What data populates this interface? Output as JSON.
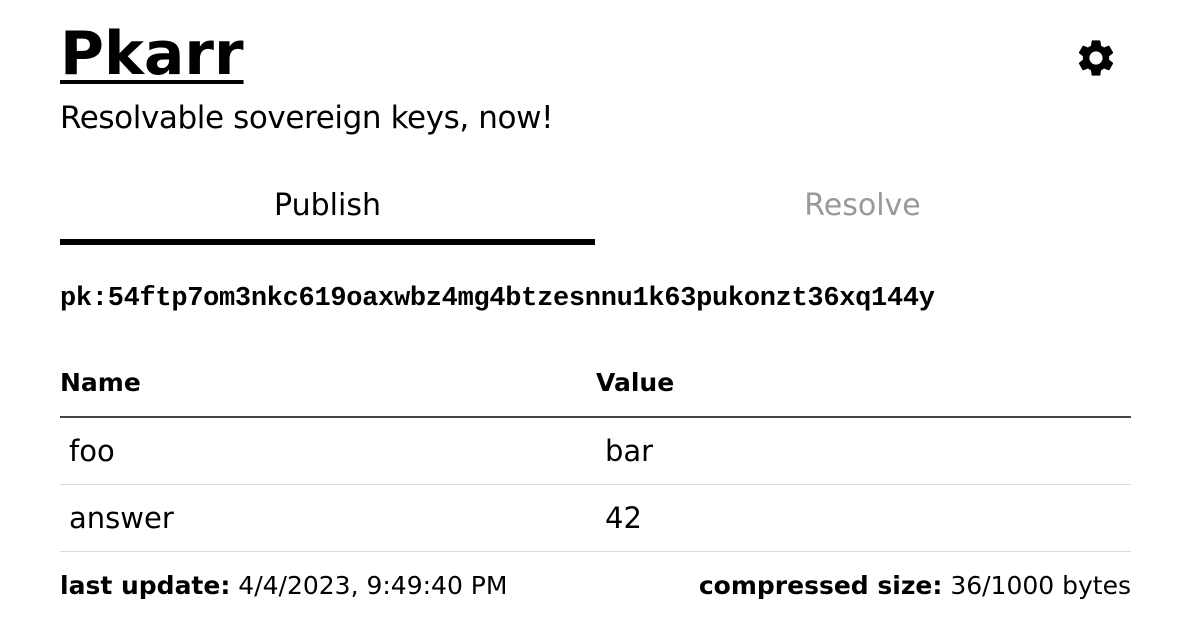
{
  "header": {
    "title": "Pkarr",
    "subtitle": "Resolvable sovereign keys, now!",
    "settings_icon": "gear-icon"
  },
  "tabs": [
    {
      "label": "Publish",
      "active": true
    },
    {
      "label": "Resolve",
      "active": false
    }
  ],
  "colors": {
    "text": "#000000",
    "inactive_tab": "#999999",
    "row_border": "#d9d9d9"
  },
  "publish": {
    "public_key": "pk:54ftp7om3nkc619oaxwbz4mg4btzesnnu1k63pukonzt36xq144y",
    "records": {
      "columns": [
        "Name",
        "Value"
      ],
      "rows": [
        {
          "name": "foo",
          "value": "bar"
        },
        {
          "name": "answer",
          "value": "42"
        }
      ]
    },
    "footer": {
      "last_update_label": "last update:",
      "last_update_value": "4/4/2023, 9:49:40 PM",
      "compressed_size_label": "compressed size:",
      "compressed_size_value": "36/1000 bytes"
    }
  }
}
